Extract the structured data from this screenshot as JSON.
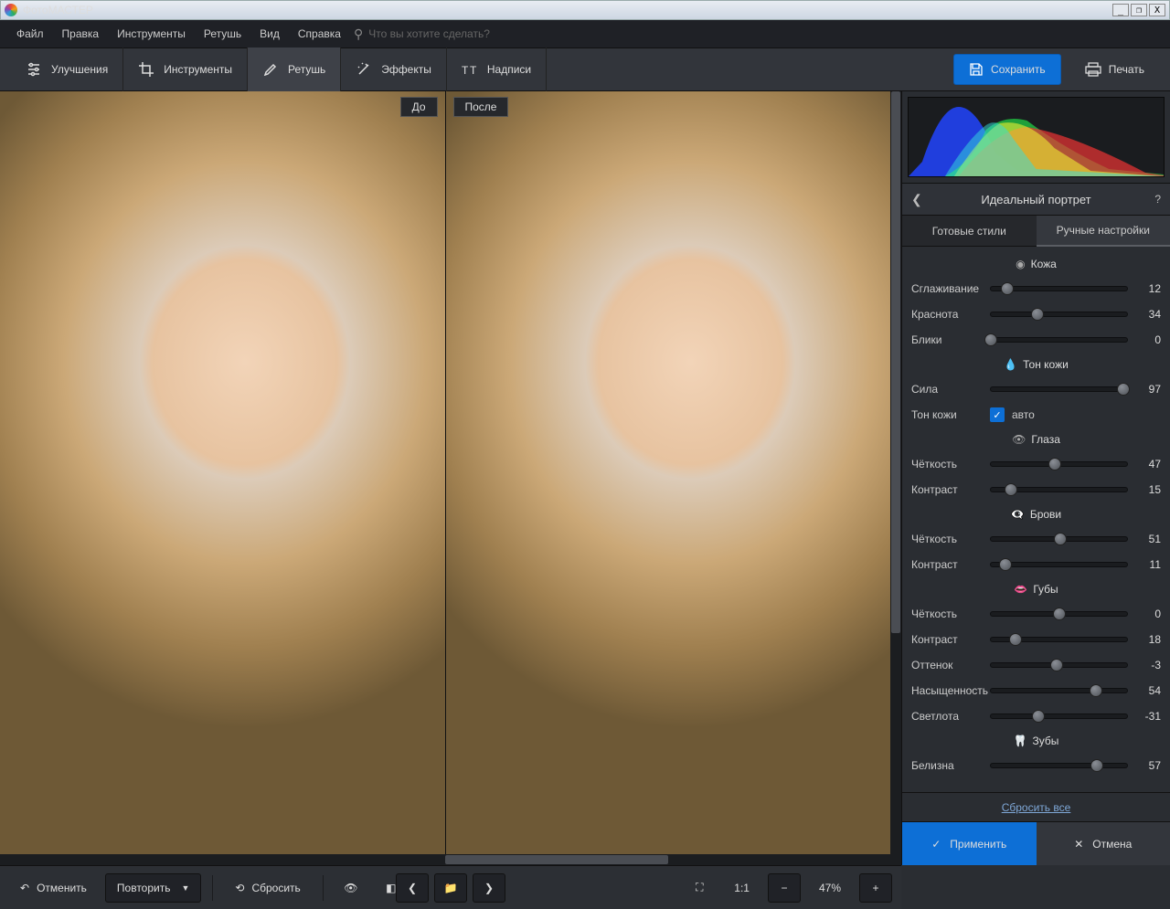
{
  "app_title": "ФотоМАСТЕР",
  "menu": [
    "Файл",
    "Правка",
    "Инструменты",
    "Ретушь",
    "Вид",
    "Справка"
  ],
  "search_placeholder": "Что вы хотите сделать?",
  "tabs": {
    "enhance": "Улучшения",
    "tools": "Инструменты",
    "retouch": "Ретушь",
    "effects": "Эффекты",
    "text": "Надписи"
  },
  "save_label": "Сохранить",
  "print_label": "Печать",
  "compare": {
    "before": "До",
    "after": "После"
  },
  "panel": {
    "title": "Идеальный портрет",
    "tab_presets": "Готовые стили",
    "tab_manual": "Ручные настройки"
  },
  "sections": {
    "skin": "Кожа",
    "skintone": "Тон кожи",
    "eyes": "Глаза",
    "brows": "Брови",
    "lips": "Губы",
    "teeth": "Зубы"
  },
  "sliders": {
    "smoothing": {
      "label": "Сглаживание",
      "value": 12,
      "pos": 12
    },
    "redness": {
      "label": "Краснота",
      "value": 34,
      "pos": 34
    },
    "shine": {
      "label": "Блики",
      "value": 0,
      "pos": 0
    },
    "strength": {
      "label": "Сила",
      "value": 97,
      "pos": 97
    },
    "skintone": {
      "label": "Тон кожи",
      "auto": "авто"
    },
    "eye_sharp": {
      "label": "Чёткость",
      "value": 47,
      "pos": 47
    },
    "eye_contr": {
      "label": "Контраст",
      "value": 15,
      "pos": 15
    },
    "brow_sharp": {
      "label": "Чёткость",
      "value": 51,
      "pos": 51
    },
    "brow_contr": {
      "label": "Контраст",
      "value": 11,
      "pos": 11
    },
    "lip_sharp": {
      "label": "Чёткость",
      "value": 0,
      "pos": 50
    },
    "lip_contr": {
      "label": "Контраст",
      "value": 18,
      "pos": 18
    },
    "lip_hue": {
      "label": "Оттенок",
      "value": -3,
      "pos": 48
    },
    "lip_sat": {
      "label": "Насыщенность",
      "value": 54,
      "pos": 77
    },
    "lip_light": {
      "label": "Светлота",
      "value": -31,
      "pos": 35
    },
    "teeth_wh": {
      "label": "Белизна",
      "value": 57,
      "pos": 78
    }
  },
  "reset_all": "Сбросить все",
  "apply": "Применить",
  "cancel": "Отмена",
  "footer": {
    "undo": "Отменить",
    "redo": "Повторить",
    "reset": "Сбросить",
    "zoom": "47%",
    "oneone": "1:1"
  }
}
